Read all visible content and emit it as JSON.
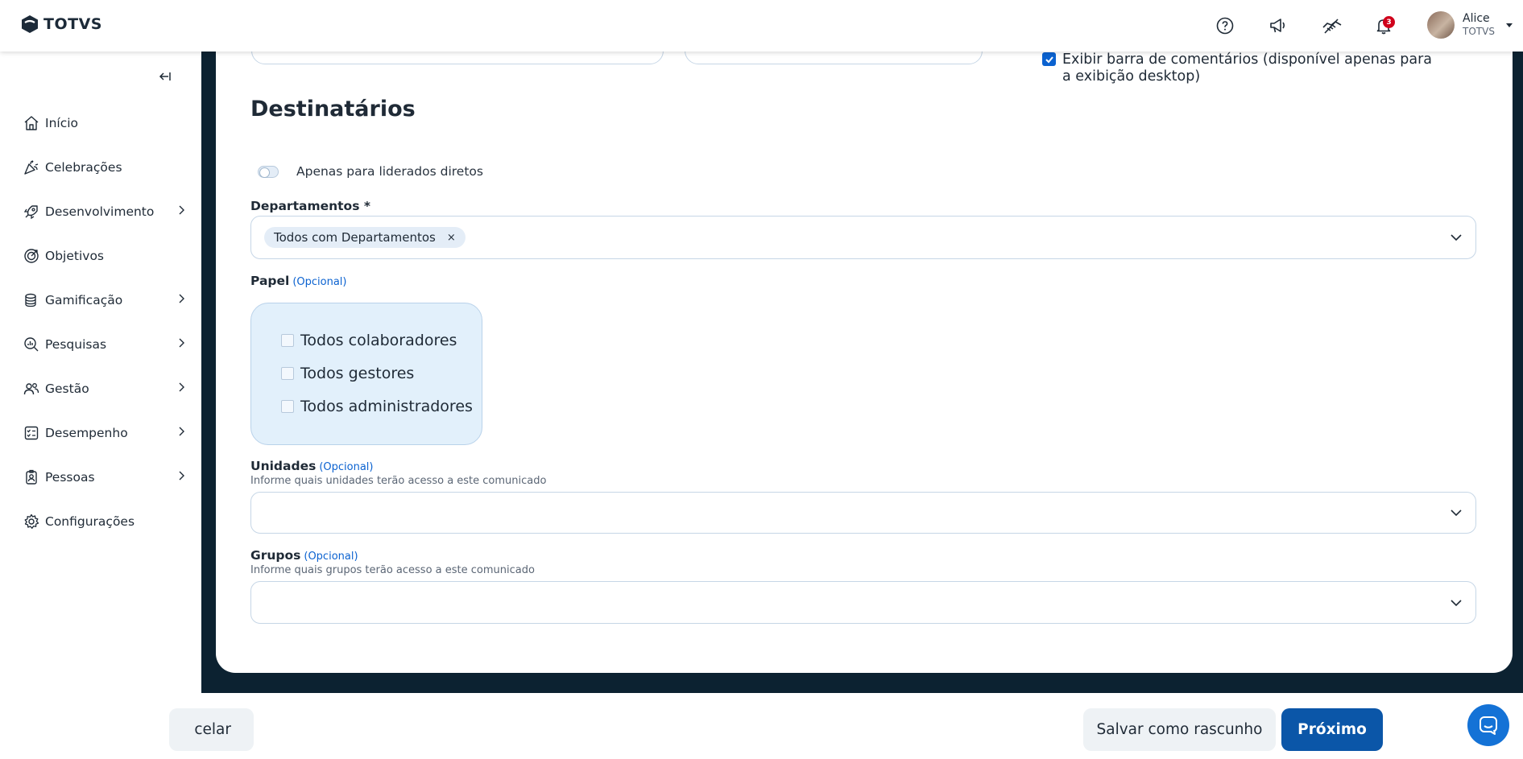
{
  "header": {
    "logo_text": "TOTVS",
    "notifications_count": "3",
    "user": {
      "name": "Alice",
      "org": "TOTVS"
    }
  },
  "sidebar": {
    "items": [
      {
        "label": "Início",
        "icon": "home-icon",
        "has_children": false
      },
      {
        "label": "Celebrações",
        "icon": "party-icon",
        "has_children": false
      },
      {
        "label": "Desenvolvimento",
        "icon": "rocket-icon",
        "has_children": true
      },
      {
        "label": "Objetivos",
        "icon": "target-icon",
        "has_children": false
      },
      {
        "label": "Gamificação",
        "icon": "coins-icon",
        "has_children": true
      },
      {
        "label": "Pesquisas",
        "icon": "survey-icon",
        "has_children": true
      },
      {
        "label": "Gestão",
        "icon": "people-icon",
        "has_children": true
      },
      {
        "label": "Desempenho",
        "icon": "checklist-icon",
        "has_children": true
      },
      {
        "label": "Pessoas",
        "icon": "badge-icon",
        "has_children": true
      },
      {
        "label": "Configurações",
        "icon": "gear-icon",
        "has_children": false
      }
    ]
  },
  "form": {
    "comments_checkbox": {
      "label": "Exibir barra de comentários (disponível apenas para a exibição desktop)",
      "checked": true
    },
    "section_title": "Destinatários",
    "direct_reports_toggle": {
      "label": "Apenas para liderados diretos",
      "on": false
    },
    "departments": {
      "label": "Departamentos *",
      "chips": [
        "Todos com Departamentos"
      ],
      "chip_remove": "×"
    },
    "role": {
      "label": "Papel",
      "optional": "(Opcional)",
      "options": [
        {
          "label": "Todos colaboradores",
          "checked": false
        },
        {
          "label": "Todos gestores",
          "checked": false
        },
        {
          "label": "Todos administradores",
          "checked": false
        }
      ]
    },
    "units": {
      "label": "Unidades",
      "optional": "(Opcional)",
      "help": "Informe quais unidades terão acesso a este comunicado",
      "value": ""
    },
    "groups": {
      "label": "Grupos",
      "optional": "(Opcional)",
      "help": "Informe quais grupos terão acesso a este comunicado",
      "value": ""
    }
  },
  "footer": {
    "cancel_label": "celar",
    "draft_label": "Salvar como rascunho",
    "next_label": "Próximo"
  },
  "colors": {
    "primary": "#0b62d0",
    "primary_dark": "#0b56a8",
    "dark_bg": "#0c2231",
    "badge": "#d0021b"
  }
}
